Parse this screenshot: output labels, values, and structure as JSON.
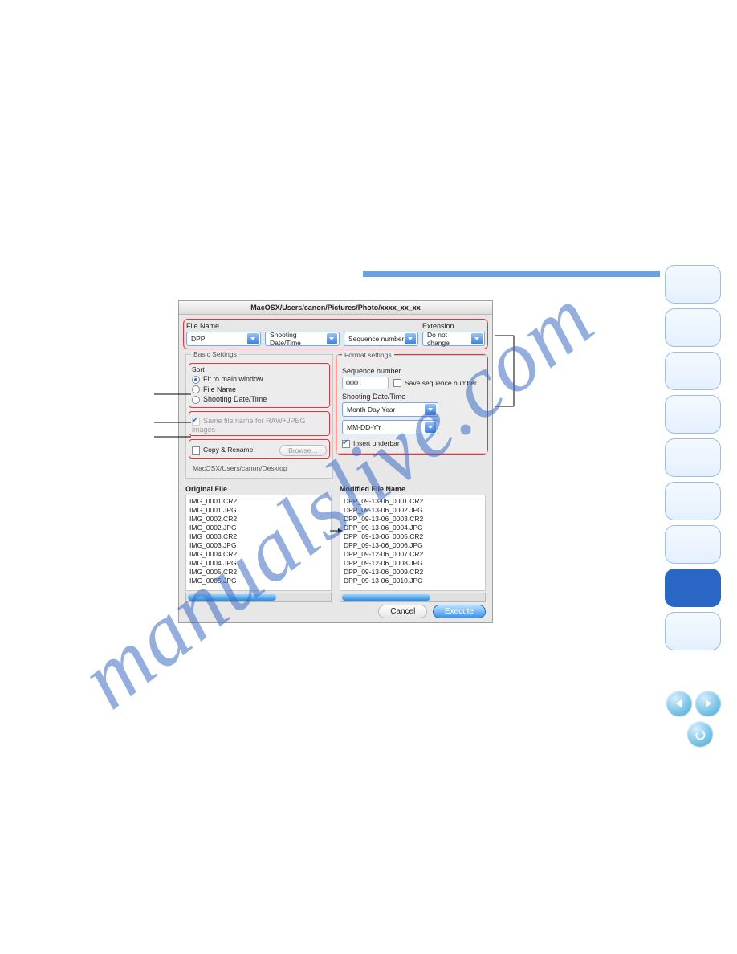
{
  "watermark": "manualslive.com",
  "dialog": {
    "title": "MacOSX/Users/canon/Pictures/Photo/xxxx_xx_xx",
    "file_name_label": "File Name",
    "extension_label": "Extension",
    "selects": {
      "s1": "DPP",
      "s2": "Shooting Date/Time",
      "s3": "Sequence number",
      "ext": "Do not change"
    },
    "basic_legend": "Basic Settings",
    "sort_label": "Sort",
    "sort_opts": {
      "o1": "Fit to main window",
      "o2": "File Name",
      "o3": "Shooting Date/Time"
    },
    "same_file": "Same file name for RAW+JPEG images",
    "copy_rename": "Copy & Rename",
    "browse": "Browse…",
    "dest_path": "MacOSX/Users/canon/Desktop",
    "format_legend": "Format settings",
    "seq_label": "Sequence number",
    "seq_value": "0001",
    "save_seq": "Save sequence number",
    "shoot_label": "Shooting Date/Time",
    "order_sel": "Month Day Year",
    "fmt_sel": "MM-DD-YY",
    "insert_underbar": "Insert underbar",
    "orig_hdr": "Original File",
    "mod_hdr": "Modified File Name",
    "orig_list": [
      "IMG_0001.CR2",
      "IMG_0001.JPG",
      "IMG_0002.CR2",
      "IMG_0002.JPG",
      "IMG_0003.CR2",
      "IMG_0003.JPG",
      "IMG_0004.CR2",
      "IMG_0004.JPG",
      "IMG_0005.CR2",
      "IMG_0005.JPG"
    ],
    "mod_list": [
      "DPP_09-13-06_0001.CR2",
      "DPP_09-13-06_0002.JPG",
      "DPP_09-13-06_0003.CR2",
      "DPP_09-13-06_0004.JPG",
      "DPP_09-13-06_0005.CR2",
      "DPP_09-13-06_0006.JPG",
      "DPP_09-12-06_0007.CR2",
      "DPP_09-12-06_0008.JPG",
      "DPP_09-13-06_0009.CR2",
      "DPP_09-13-06_0010.JPG"
    ],
    "cancel": "Cancel",
    "execute": "Execute"
  }
}
